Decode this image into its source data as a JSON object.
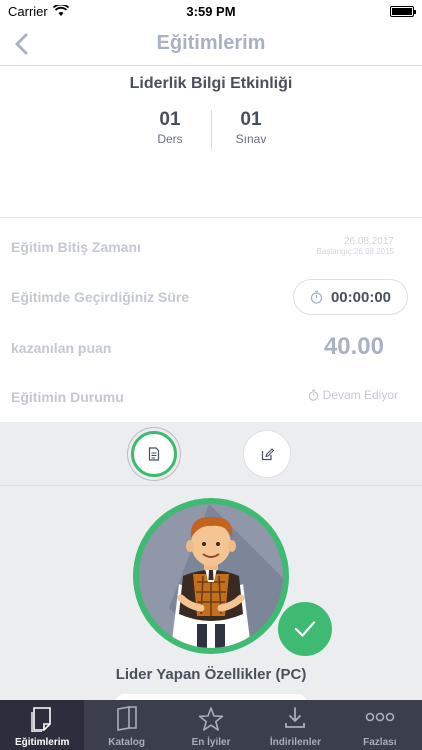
{
  "status_bar": {
    "carrier": "Carrier",
    "time": "3:59 PM"
  },
  "nav": {
    "title": "Eğitimlerim"
  },
  "course": {
    "title": "Liderlik Bilgi Etkinliği",
    "lessons_count": "01",
    "lessons_label": "Ders",
    "exams_count": "01",
    "exams_label": "Sınav"
  },
  "info": {
    "end_time_label": "Eğitim Bitiş Zamanı",
    "end_date": "26.08.2017",
    "start_date": "Başlangıç:26.08.2015",
    "time_spent_label": "Eğitimde Geçirdiğiniz Süre",
    "time_spent": "00:00:00",
    "points_label": "kazanılan puan",
    "points": "40.00",
    "status_label": "Eğitimin Durumu",
    "status_value": "Devam Ediyor"
  },
  "lesson": {
    "title": "Lider Yapan Özellikler (PC)",
    "completed": true
  },
  "tabbar": {
    "items": [
      {
        "label": "Eğitimlerim",
        "icon": "document-icon",
        "active": true
      },
      {
        "label": "Katalog",
        "icon": "book-icon",
        "active": false
      },
      {
        "label": "En İyiler",
        "icon": "star-icon",
        "active": false
      },
      {
        "label": "İndirilenler",
        "icon": "download-icon",
        "active": false
      },
      {
        "label": "Fazlası",
        "icon": "more-icon",
        "active": false
      }
    ]
  },
  "colors": {
    "accent": "#3fba73",
    "tabbar_bg": "#3a3e4d",
    "title_gray": "#a9b1c4"
  }
}
